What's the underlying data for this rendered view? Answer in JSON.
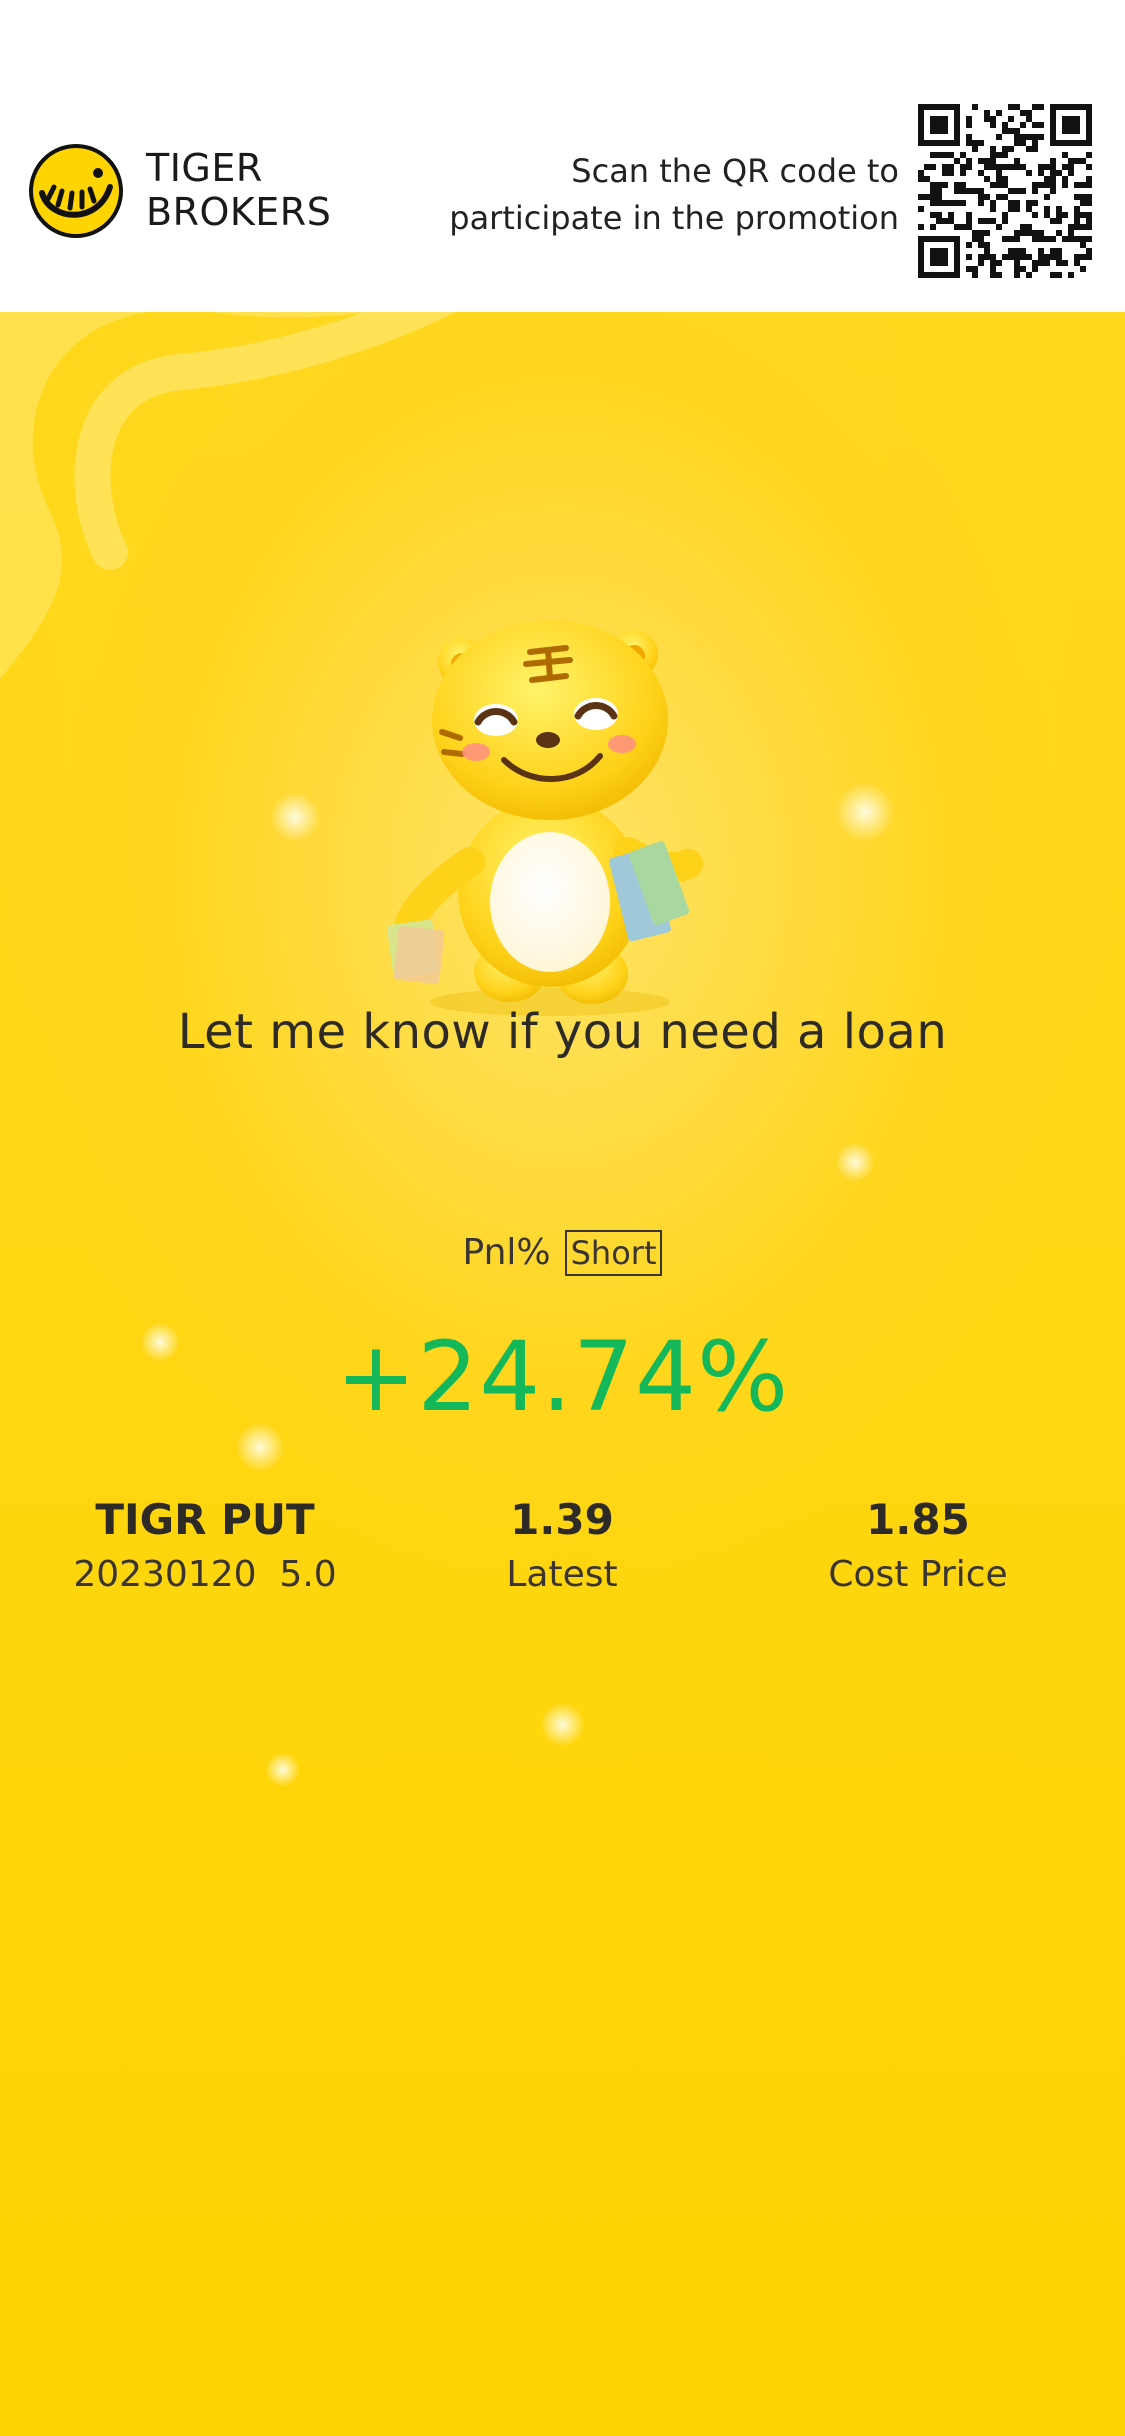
{
  "header": {
    "brand_line1": "TIGER",
    "brand_line2": "BROKERS",
    "scan_line1": "Scan the QR code to",
    "scan_line2": "participate in the promotion"
  },
  "promo": {
    "slogan": "Let me know if you need a loan"
  },
  "pnl": {
    "label": "Pnl%",
    "direction": "Short",
    "value": "+24.74%"
  },
  "stats": [
    {
      "main": "TIGR PUT",
      "sub": "20230120  5.0"
    },
    {
      "main": "1.39",
      "sub": "Latest"
    },
    {
      "main": "1.85",
      "sub": "Cost Price"
    }
  ],
  "colors": {
    "brand_yellow": "#ffd400",
    "profit_green": "#14b85a",
    "text_dark": "#2e2a25"
  }
}
